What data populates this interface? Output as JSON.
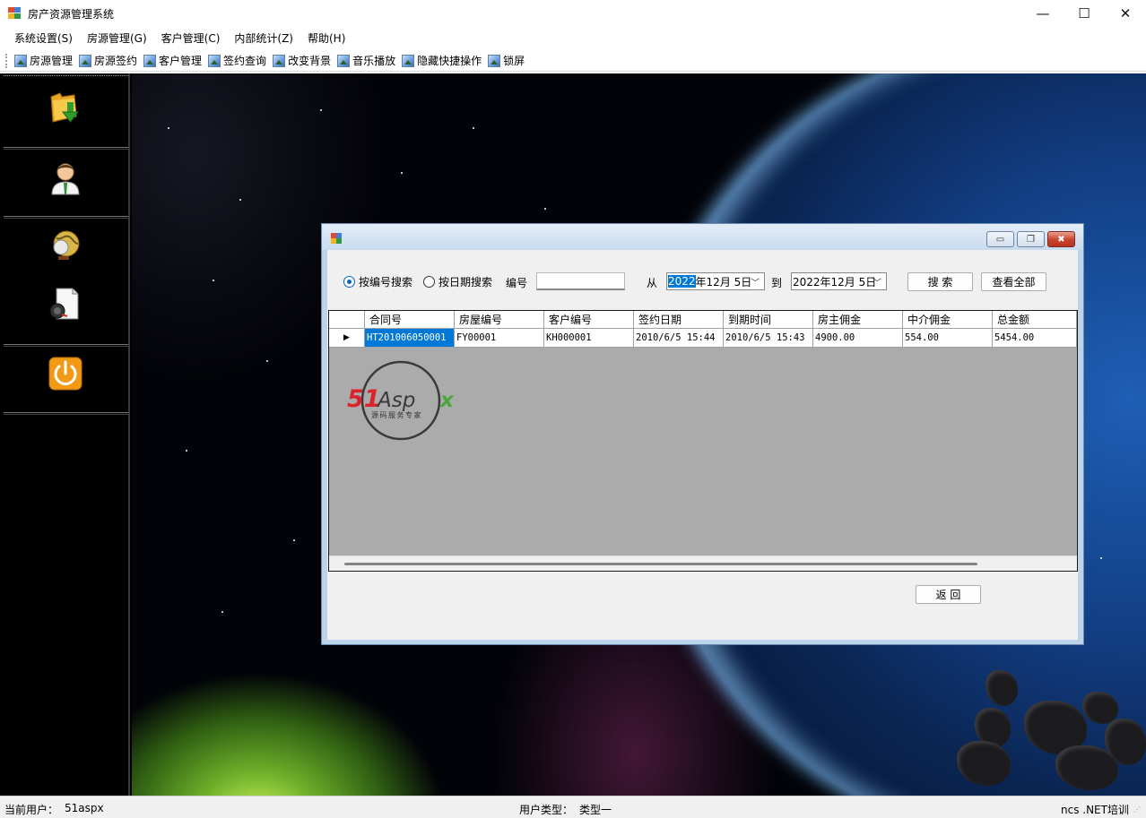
{
  "window": {
    "title": "房产资源管理系统",
    "minimize_glyph": "—",
    "maximize_glyph": "☐",
    "close_glyph": "✕"
  },
  "menu": [
    "系统设置(S)",
    "房源管理(G)",
    "客户管理(C)",
    "内部统计(Z)",
    "帮助(H)"
  ],
  "toolbar": [
    "房源管理",
    "房源签约",
    "客户管理",
    "签约查询",
    "改变背景",
    "音乐播放",
    "隐藏快捷操作",
    "锁屏"
  ],
  "sidebar_icons": [
    "folder-download-icon",
    "user-icon",
    "globe-icon",
    "document-search-icon",
    "power-icon"
  ],
  "dialog": {
    "min_glyph": "▭",
    "restore_glyph": "❐",
    "close_glyph": "✖",
    "search_by_id": "按编号搜索",
    "search_by_date": "按日期搜索",
    "selected_search_mode": "按编号搜索",
    "id_label": "编号",
    "id_value": "",
    "from_label": "从",
    "from_date_selected": "2022",
    "from_date_rest": "年12月 5日",
    "to_label": "到",
    "to_date": "2022年12月 5日",
    "search_button": "搜 索",
    "view_all_button": "查看全部",
    "back_button": "返 回",
    "grid": {
      "columns": [
        "合同号",
        "房屋编号",
        "客户编号",
        "签约日期",
        "到期时间",
        "房主佣金",
        "中介佣金",
        "总金额"
      ],
      "rows": [
        [
          "HT201006050001",
          "FY00001",
          "KH000001",
          "2010/6/5 15:44",
          "2010/6/5 15:43",
          "4900.00",
          "554.00",
          "5454.00"
        ]
      ],
      "row_marker": "▶"
    },
    "watermark": {
      "brand": "51Aspx",
      "tagline": "源码服务专家"
    }
  },
  "status": {
    "current_user_label": "当前用户：",
    "current_user": "51aspx",
    "user_type_label": "用户类型：",
    "user_type": "类型一",
    "footer": "ncs .NET培训"
  }
}
